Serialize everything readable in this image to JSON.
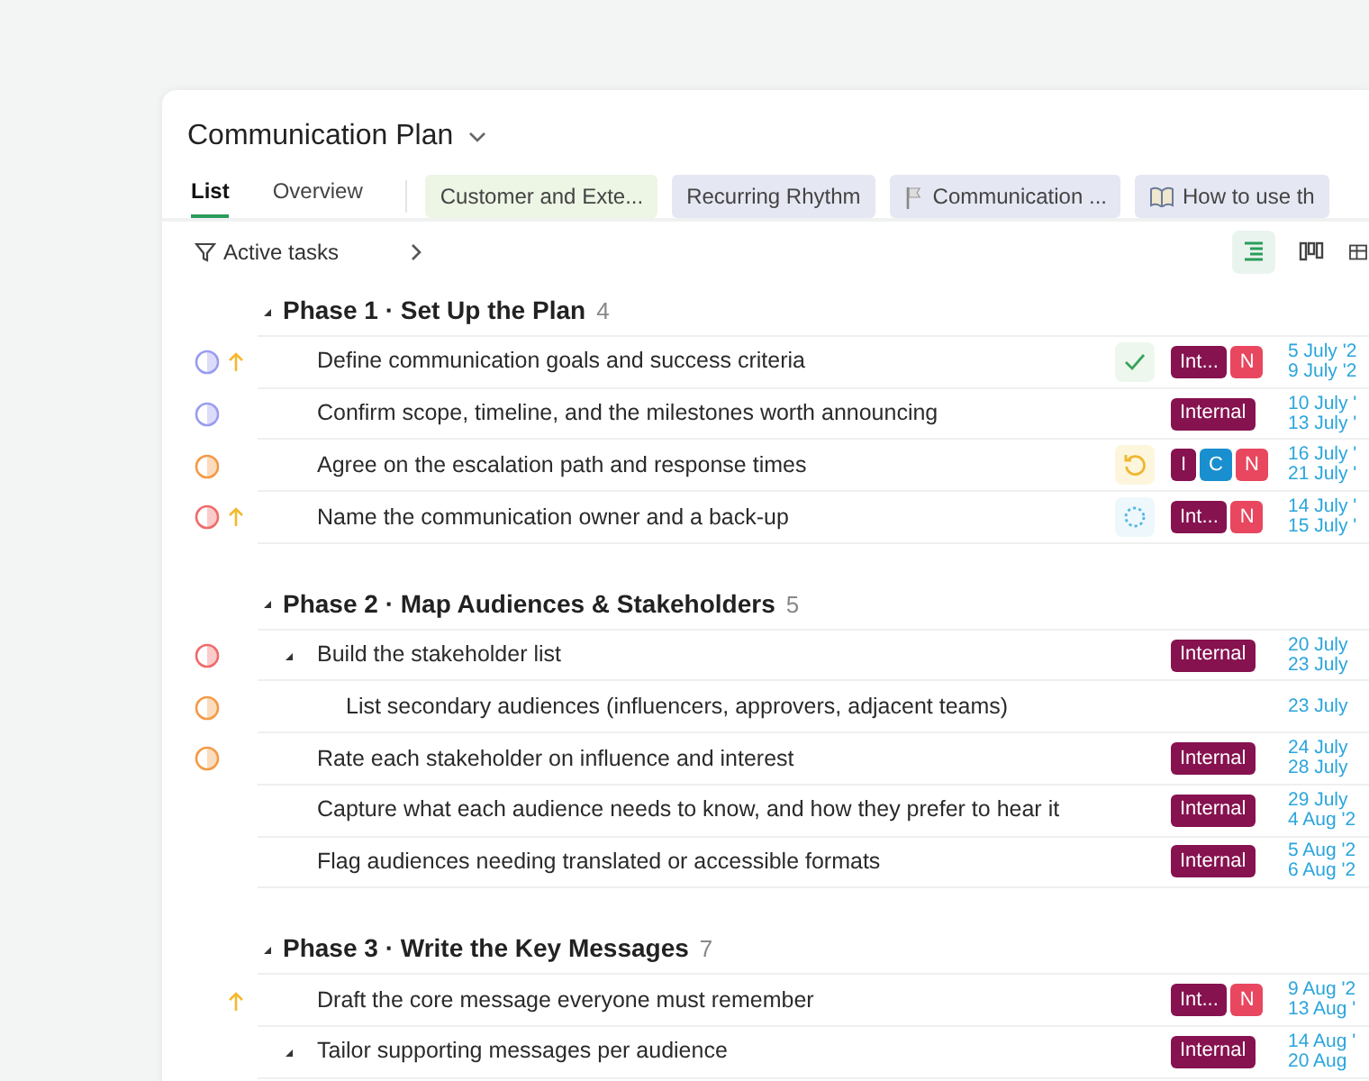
{
  "header": {
    "title": "Communication Plan"
  },
  "tabs": [
    {
      "label": "List",
      "kind": "plain",
      "selected": true
    },
    {
      "label": "Overview",
      "kind": "plain",
      "selected": false
    },
    {
      "label": "Customer and Exte...",
      "kind": "chip",
      "color": "#edf6e5",
      "selected": false
    },
    {
      "label": "Recurring Rhythm",
      "kind": "chip",
      "color": "#e5e7f3",
      "selected": false
    },
    {
      "label": "Communication ...",
      "kind": "flag",
      "color": "#e5e7f3",
      "selected": false
    },
    {
      "label": "How to use th",
      "kind": "book",
      "color": "#e5e7f3",
      "selected": false
    }
  ],
  "filter": {
    "label": "Active tasks"
  },
  "views": [
    {
      "selected": true
    },
    {
      "selected": false
    },
    {
      "selected": false
    }
  ],
  "phases": [
    {
      "title": "Phase 1 · Set Up the Plan",
      "count": "4",
      "expanded": true,
      "tasks": [
        {
          "title": "Define communication goals and success criteria",
          "color": "#9a9cf0",
          "high_priority": true,
          "kind": "check",
          "tags": [
            {
              "label": "Int...",
              "color": "#86124f"
            },
            {
              "label": "N",
              "color": "#e8475f"
            }
          ],
          "dates": [
            "5 July '2",
            "9 July '2"
          ]
        },
        {
          "title": "Confirm scope, timeline, and the milestones worth announcing",
          "color": "#9a9cf0",
          "high_priority": false,
          "tags": [
            {
              "label": "Internal",
              "color": "#86124f"
            }
          ],
          "dates": [
            "10 July '",
            "13 July '"
          ]
        },
        {
          "title": "Agree on the escalation path and response times",
          "color": "#f59a45",
          "high_priority": false,
          "kind": "reopen",
          "tags": [
            {
              "label": "I",
              "color": "#86124f"
            },
            {
              "label": "C",
              "color": "#1a8fd0"
            },
            {
              "label": "N",
              "color": "#e8475f"
            }
          ],
          "dates": [
            "16 July '",
            "21 July '"
          ]
        },
        {
          "title": "Name the communication owner and a back-up",
          "color": "#f06a6a",
          "high_priority": true,
          "kind": "progress",
          "tags": [
            {
              "label": "Int...",
              "color": "#86124f"
            },
            {
              "label": "N",
              "color": "#e8475f"
            }
          ],
          "dates": [
            "14 July '",
            "15 July '"
          ]
        }
      ]
    },
    {
      "title": "Phase 2 · Map Audiences & Stakeholders",
      "count": "5",
      "expanded": true,
      "tasks": [
        {
          "title": "Build the stakeholder list",
          "color": "#f06a6a",
          "high_priority": false,
          "expanded": true,
          "tags": [
            {
              "label": "Internal",
              "color": "#86124f"
            }
          ],
          "dates": [
            "20 July",
            "23 July"
          ],
          "children": [
            {
              "title": "List secondary audiences (influencers, approvers, adjacent teams)",
              "color": "#f59a45",
              "high_priority": false,
              "dates": [
                "23 July"
              ]
            }
          ]
        },
        {
          "title": "Rate each stakeholder on influence and interest",
          "color": "#f59a45",
          "high_priority": false,
          "tags": [
            {
              "label": "Internal",
              "color": "#86124f"
            }
          ],
          "dates": [
            "24 July",
            "28 July"
          ]
        },
        {
          "title": "Capture what each audience needs to know, and how they prefer to hear it",
          "high_priority": false,
          "tags": [
            {
              "label": "Internal",
              "color": "#86124f"
            }
          ],
          "dates": [
            "29 July",
            "4 Aug '2"
          ]
        },
        {
          "title": "Flag audiences needing translated or accessible formats",
          "high_priority": false,
          "tags": [
            {
              "label": "Internal",
              "color": "#86124f"
            }
          ],
          "dates": [
            "5 Aug '2",
            "6 Aug '2"
          ]
        }
      ]
    },
    {
      "title": "Phase 3 · Write the Key Messages",
      "count": "7",
      "expanded": true,
      "tasks": [
        {
          "title": "Draft the core message everyone must remember",
          "high_priority": true,
          "tags": [
            {
              "label": "Int...",
              "color": "#86124f"
            },
            {
              "label": "N",
              "color": "#e8475f"
            }
          ],
          "dates": [
            "9 Aug '2",
            "13 Aug '"
          ]
        },
        {
          "title": "Tailor supporting messages per audience",
          "high_priority": false,
          "expanded": true,
          "tags": [
            {
              "label": "Internal",
              "color": "#86124f"
            }
          ],
          "dates": [
            "14 Aug '",
            "20 Aug"
          ]
        }
      ]
    }
  ]
}
